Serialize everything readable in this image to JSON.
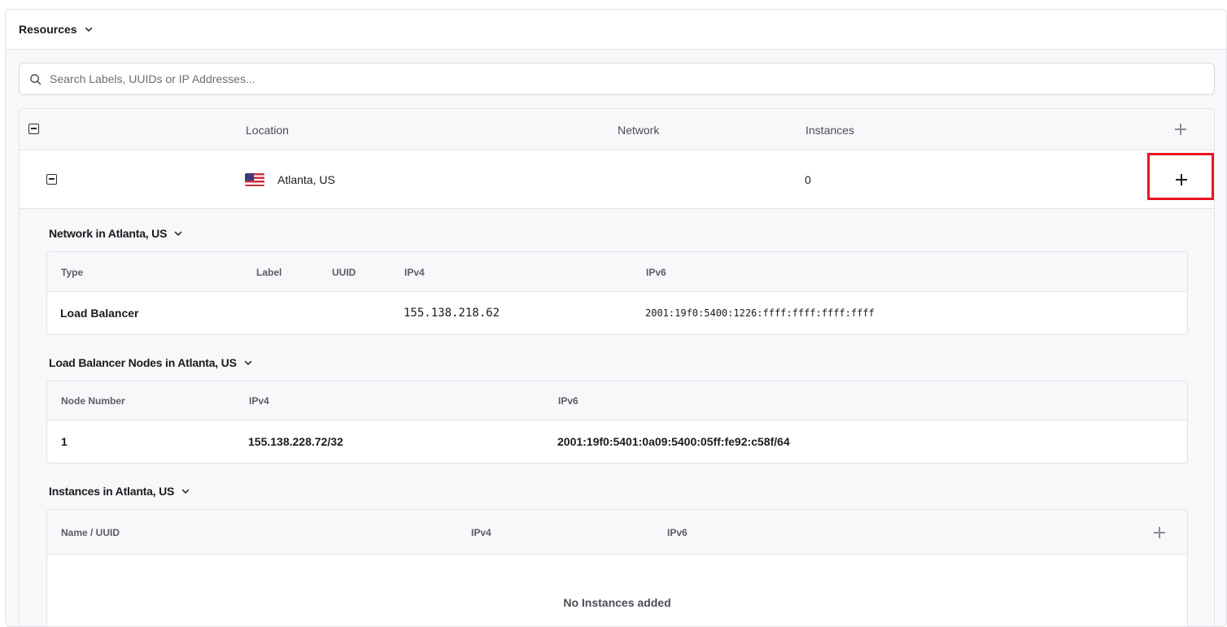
{
  "panel": {
    "title": "Resources"
  },
  "search": {
    "placeholder": "Search Labels, UUIDs or IP Addresses..."
  },
  "locations_table": {
    "columns": {
      "location": "Location",
      "network": "Network",
      "instances": "Instances"
    },
    "rows": [
      {
        "location": "Atlanta, US",
        "flag": "us-flag",
        "network": "",
        "instances": "0"
      }
    ]
  },
  "network_section": {
    "title": "Network in Atlanta, US",
    "columns": {
      "type": "Type",
      "label": "Label",
      "uuid": "UUID",
      "ipv4": "IPv4",
      "ipv6": "IPv6"
    },
    "rows": [
      {
        "type": "Load Balancer",
        "label": "",
        "uuid": "",
        "ipv4": "155.138.218.62",
        "ipv6": "2001:19f0:5400:1226:ffff:ffff:ffff:ffff"
      }
    ]
  },
  "nodes_section": {
    "title": "Load Balancer Nodes in Atlanta, US",
    "columns": {
      "node_number": "Node Number",
      "ipv4": "IPv4",
      "ipv6": "IPv6"
    },
    "rows": [
      {
        "node_number": "1",
        "ipv4": "155.138.228.72/32",
        "ipv6": "2001:19f0:5401:0a09:5400:05ff:fe92:c58f/64"
      }
    ]
  },
  "instances_section": {
    "title": "Instances in Atlanta, US",
    "columns": {
      "name_uuid": "Name / UUID",
      "ipv4": "IPv4",
      "ipv6": "IPv6"
    },
    "empty_text": "No Instances added"
  },
  "colors": {
    "highlight": "#e8141e",
    "header_bg": "#f7f8fa",
    "border": "#e3e4e8"
  }
}
